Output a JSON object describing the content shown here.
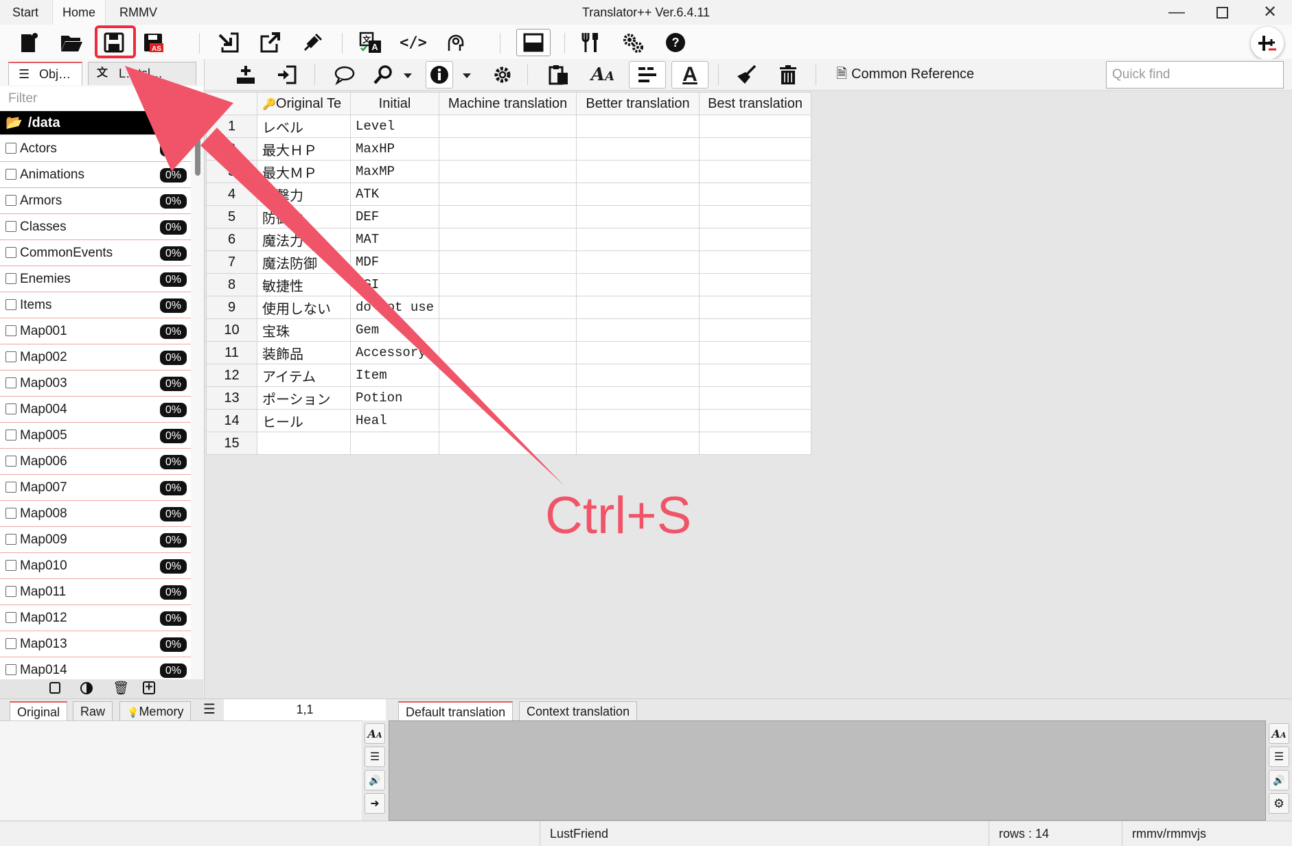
{
  "window": {
    "title": "Translator++ Ver.6.4.11",
    "menu_tabs": [
      "Start",
      "Home",
      "RMMV"
    ],
    "active_menu": "Home"
  },
  "left_panel": {
    "tabs": [
      "Obj…",
      "L…tsl…"
    ],
    "filter_placeholder": "Filter",
    "folder": "/data",
    "objects": [
      {
        "name": "Actors",
        "progress": "0%"
      },
      {
        "name": "Animations",
        "progress": "0%"
      },
      {
        "name": "Armors",
        "progress": "0%"
      },
      {
        "name": "Classes",
        "progress": "0%"
      },
      {
        "name": "CommonEvents",
        "progress": "0%"
      },
      {
        "name": "Enemies",
        "progress": "0%"
      },
      {
        "name": "Items",
        "progress": "0%"
      },
      {
        "name": "Map001",
        "progress": "0%"
      },
      {
        "name": "Map002",
        "progress": "0%"
      },
      {
        "name": "Map003",
        "progress": "0%"
      },
      {
        "name": "Map004",
        "progress": "0%"
      },
      {
        "name": "Map005",
        "progress": "0%"
      },
      {
        "name": "Map006",
        "progress": "0%"
      },
      {
        "name": "Map007",
        "progress": "0%"
      },
      {
        "name": "Map008",
        "progress": "0%"
      },
      {
        "name": "Map009",
        "progress": "0%"
      },
      {
        "name": "Map010",
        "progress": "0%"
      },
      {
        "name": "Map011",
        "progress": "0%"
      },
      {
        "name": "Map012",
        "progress": "0%"
      },
      {
        "name": "Map013",
        "progress": "0%"
      },
      {
        "name": "Map014",
        "progress": "0%"
      }
    ]
  },
  "toolbar2": {
    "common_reference": "Common Reference",
    "quick_find_placeholder": "Quick find"
  },
  "grid": {
    "columns": [
      "Original Te",
      "Initial",
      "Machine translation",
      "Better translation",
      "Best translation"
    ],
    "rows": [
      {
        "n": "1",
        "original": "レベル",
        "initial": "Level"
      },
      {
        "n": "2",
        "original": "最大ＨＰ",
        "initial": "MaxHP"
      },
      {
        "n": "3",
        "original": "最大ＭＰ",
        "initial": "MaxMP"
      },
      {
        "n": "4",
        "original": "攻撃力",
        "initial": "ATK"
      },
      {
        "n": "5",
        "original": "防御力",
        "initial": "DEF"
      },
      {
        "n": "6",
        "original": "魔法力",
        "initial": "MAT"
      },
      {
        "n": "7",
        "original": "魔法防御",
        "initial": "MDF"
      },
      {
        "n": "8",
        "original": "敏捷性",
        "initial": "AGI"
      },
      {
        "n": "9",
        "original": "使用しない",
        "initial": "do not use"
      },
      {
        "n": "10",
        "original": "宝珠",
        "initial": "Gem"
      },
      {
        "n": "11",
        "original": "装飾品",
        "initial": "Accessory"
      },
      {
        "n": "12",
        "original": "アイテム",
        "initial": "Item"
      },
      {
        "n": "13",
        "original": "ポーション",
        "initial": "Potion"
      },
      {
        "n": "14",
        "original": "ヒール",
        "initial": "Heal"
      },
      {
        "n": "15",
        "original": "",
        "initial": ""
      }
    ]
  },
  "editor": {
    "left_tabs": [
      "Original",
      "Raw",
      "Memory"
    ],
    "coordinates": "1,1",
    "right_tabs": [
      "Default translation",
      "Context translation"
    ]
  },
  "status": {
    "project": "LustFriend",
    "rows": "rows : 14",
    "engine": "rmmv/rmmvjs"
  },
  "annotation": {
    "shortcut": "Ctrl+S",
    "color": "#f05468"
  }
}
